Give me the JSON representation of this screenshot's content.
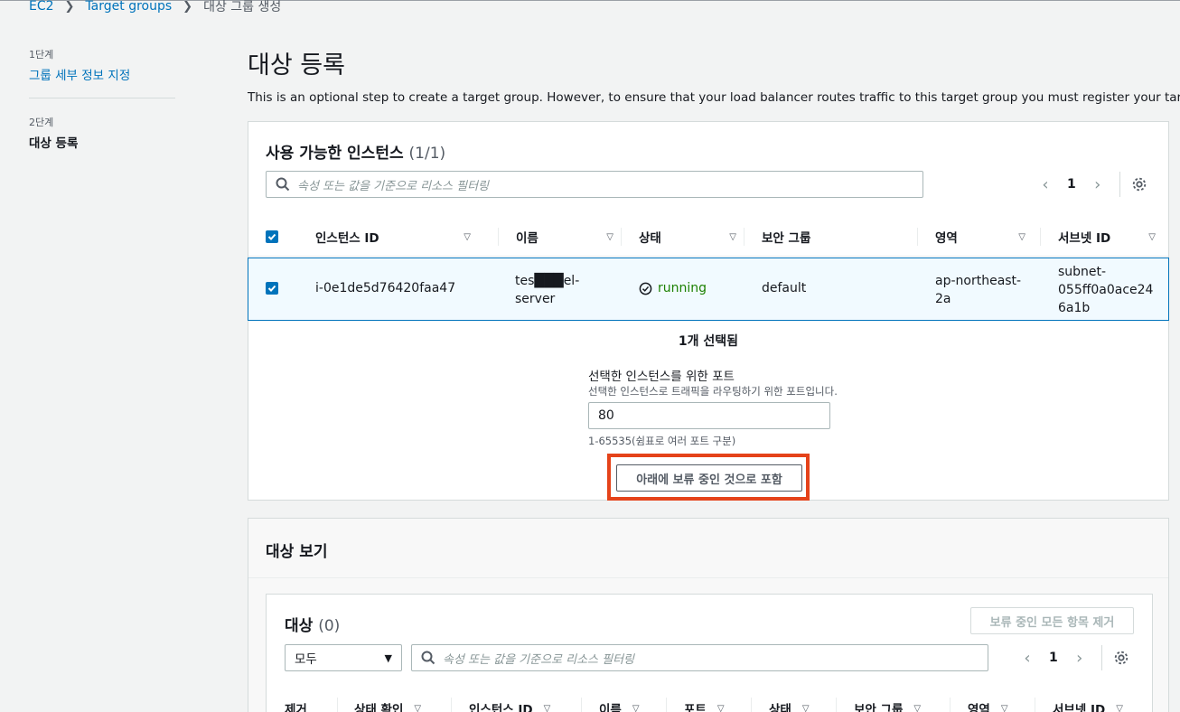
{
  "breadcrumb": {
    "root": "EC2",
    "parent": "Target groups",
    "current": "대상 그룹 생성"
  },
  "steps": {
    "step1_num": "1단계",
    "step1_label": "그룹 세부 정보 지정",
    "step2_num": "2단계",
    "step2_label": "대상 등록"
  },
  "page": {
    "title": "대상 등록",
    "description": "This is an optional step to create a target group. However, to ensure that your load balancer routes traffic to this target group you must register your targets."
  },
  "available": {
    "title": "사용 가능한 인스턴스",
    "count": "(1/1)",
    "search_placeholder": "속성 또는 값을 기준으로 리소스 필터링",
    "page": "1",
    "columns": [
      "인스턴스 ID",
      "이름",
      "상태",
      "보안 그룹",
      "영역",
      "서브넷 ID"
    ],
    "row": {
      "instance_id": "i-0e1de5d76420faa47",
      "name_line1": "tes███el-",
      "name_line2": "server",
      "status": "running",
      "security_group": "default",
      "zone_line1": "ap-northeast-",
      "zone_line2": "2a",
      "subnet_line1": "subnet-",
      "subnet_line2": "055ff0a0ace24",
      "subnet_line3": "6a1b"
    },
    "selected_count": "1개 선택됨",
    "port_label": "선택한 인스턴스를 위한 포트",
    "port_desc": "선택한 인스턴스로 트래픽을 라우팅하기 위한 포트입니다.",
    "port_value": "80",
    "port_hint": "1-65535(쉼표로 여러 포트 구분)",
    "include_button": "아래에 보류 중인 것으로 포함"
  },
  "review": {
    "title": "대상 보기",
    "targets_title": "대상",
    "targets_count": "(0)",
    "remove_all_button": "보류 중인 모든 항목 제거",
    "filter_select": "모두",
    "search_placeholder": "속성 또는 값을 기준으로 리소스 필터링",
    "page": "1",
    "columns": [
      "제거",
      "상태 확인",
      "인스턴스 ID",
      "이름",
      "포트",
      "상태",
      "보안 그룹",
      "영역",
      "서브넷 ID"
    ]
  },
  "colors": {
    "link": "#0073bb",
    "running": "#1d8102",
    "highlight": "#e5431a"
  }
}
